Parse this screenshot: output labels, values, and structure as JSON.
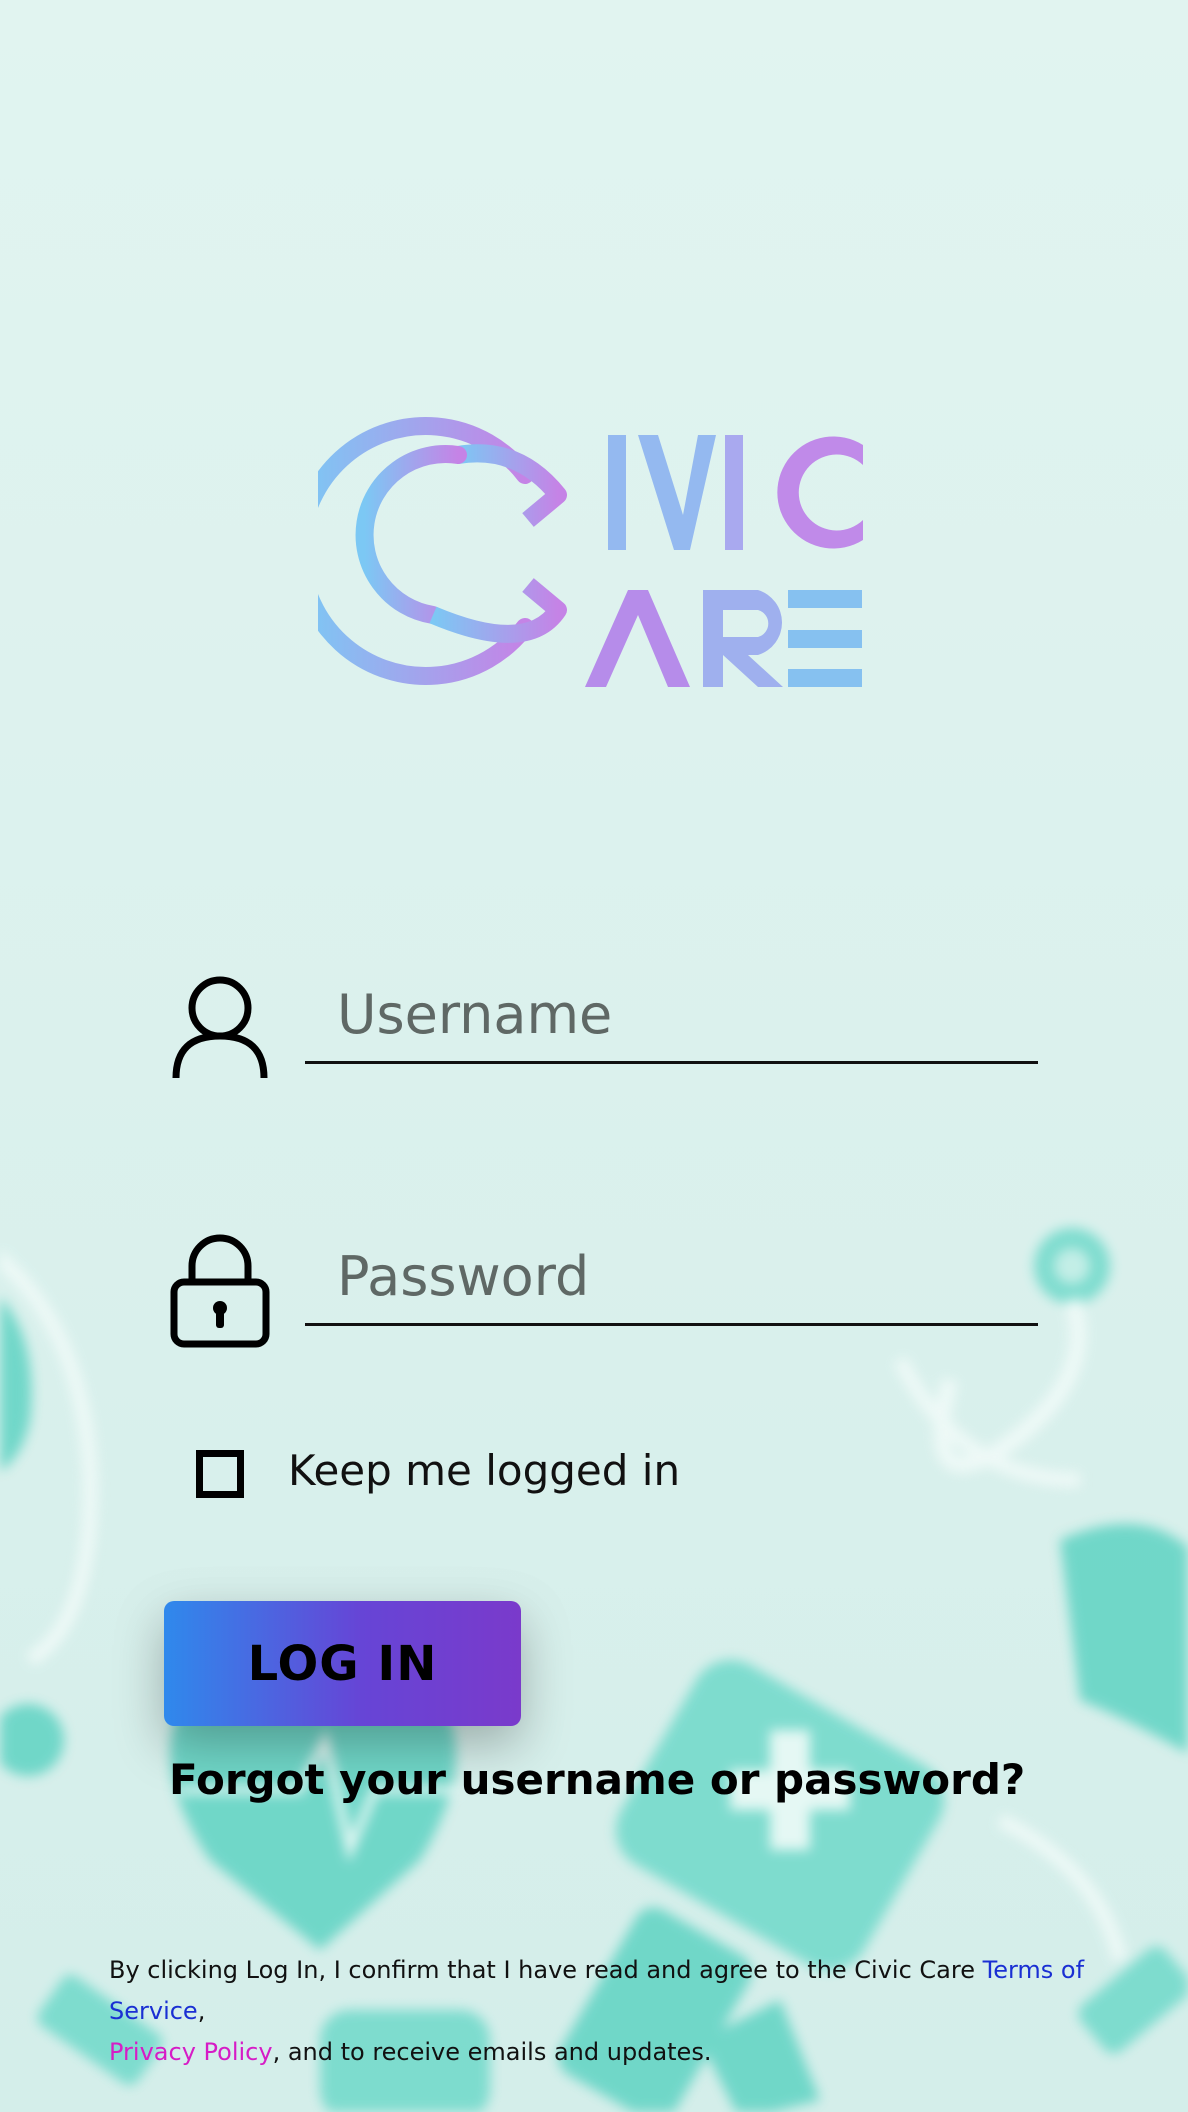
{
  "logo": {
    "text_top": "IVIC",
    "text_bottom": "ARE",
    "gradient_start": "#7cc8f4",
    "gradient_end": "#c583e6"
  },
  "login_form": {
    "username": {
      "icon": "user-icon",
      "placeholder": "Username",
      "value": ""
    },
    "password": {
      "icon": "lock-icon",
      "placeholder": "Password",
      "value": ""
    },
    "keep_logged_in": {
      "label": "Keep me logged in",
      "checked": false
    },
    "login_button": {
      "label": "LOG IN",
      "gradient_start": "#2f89ec",
      "gradient_end": "#7a3acb"
    },
    "forgot_link": "Forgot your username or password?"
  },
  "legal": {
    "prefix": "By clicking Log In, I confirm that I have read and agree to the Civic Care ",
    "terms_link": "Terms of Service",
    "separator": ",",
    "privacy_link": "Privacy Policy",
    "suffix": ", and to receive emails and updates.",
    "terms_color": "#1a2fd3",
    "privacy_color": "#d61cc6"
  },
  "theme": {
    "background": "#dff3ef",
    "decor_color": "#5fd3c3"
  }
}
